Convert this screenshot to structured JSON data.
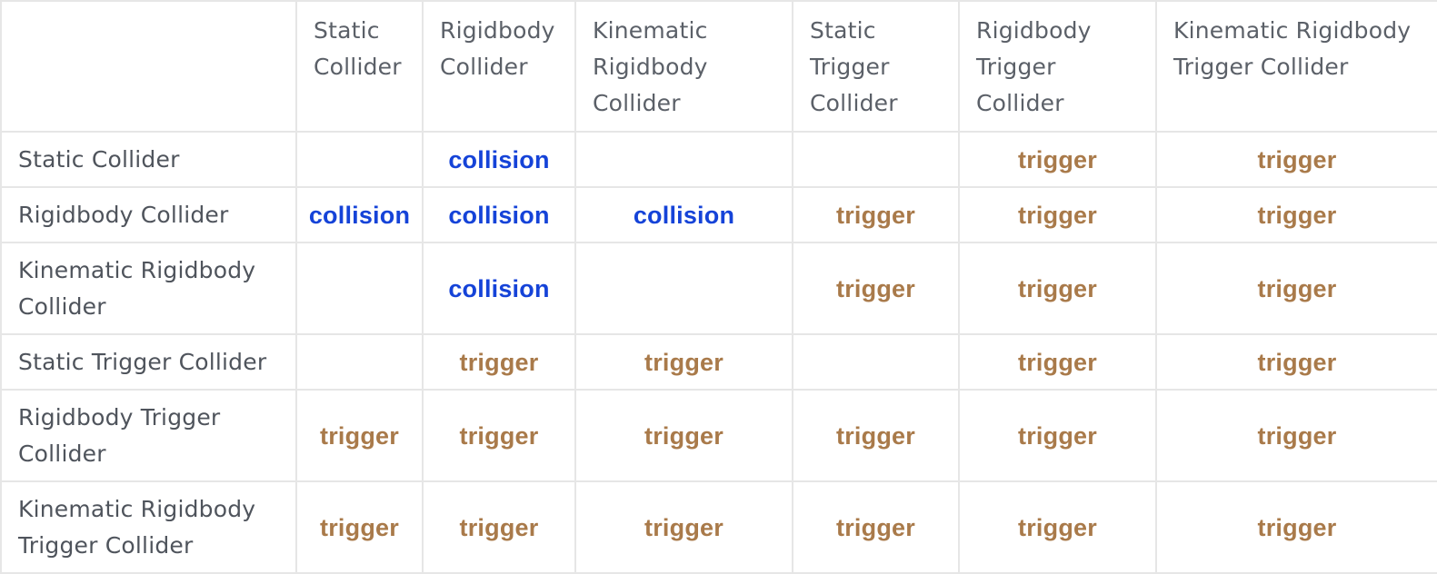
{
  "columns": [
    "",
    "Static Collider",
    "Rigidbody Collider",
    "Kinematic Rigidbody Collider",
    "Static Trigger Collider",
    "Rigidbody Trigger Collider",
    "Kinematic Rigidbody Trigger Collider"
  ],
  "rows": [
    {
      "label": "Static Collider",
      "cells": [
        "",
        "collision",
        "",
        "",
        "trigger",
        "trigger"
      ]
    },
    {
      "label": "Rigidbody Collider",
      "cells": [
        "collision",
        "collision",
        "collision",
        "trigger",
        "trigger",
        "trigger"
      ]
    },
    {
      "label": "Kinematic Rigidbody Collider",
      "cells": [
        "",
        "collision",
        "",
        "trigger",
        "trigger",
        "trigger"
      ]
    },
    {
      "label": "Static Trigger Collider",
      "cells": [
        "",
        "trigger",
        "trigger",
        "",
        "trigger",
        "trigger"
      ]
    },
    {
      "label": "Rigidbody Trigger Collider",
      "cells": [
        "trigger",
        "trigger",
        "trigger",
        "trigger",
        "trigger",
        "trigger"
      ]
    },
    {
      "label": "Kinematic Rigidbody Trigger Collider",
      "cells": [
        "trigger",
        "trigger",
        "trigger",
        "trigger",
        "trigger",
        "trigger"
      ]
    }
  ],
  "colors": {
    "collision": "#1543d8",
    "trigger": "#a97a4a",
    "text": "#4a4f57",
    "border": "#e6e6e6"
  }
}
